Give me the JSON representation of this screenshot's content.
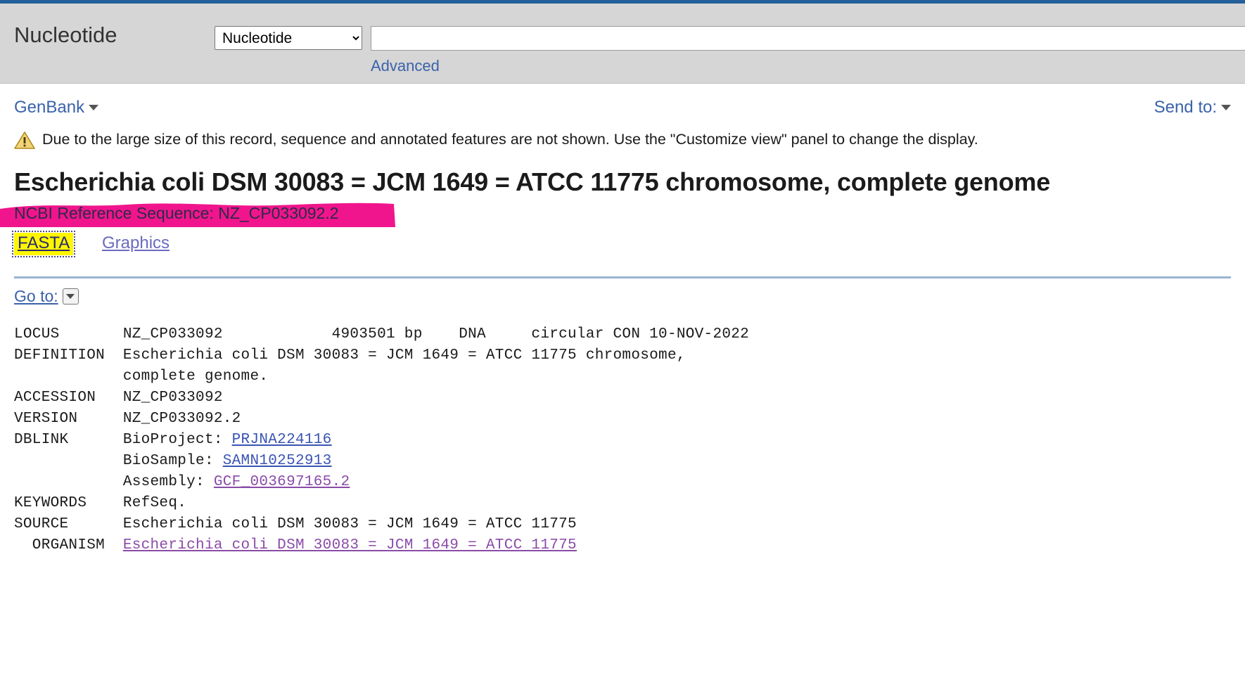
{
  "header": {
    "db_title": "Nucleotide",
    "db_select_value": "Nucleotide",
    "db_select_options": [
      "Nucleotide"
    ],
    "search_value": "",
    "search_placeholder": "",
    "advanced_label": "Advanced",
    "accent_color": "#24609b",
    "band_color": "#d6d6d6",
    "link_color": "#3a62ab"
  },
  "toolbar": {
    "format_label": "GenBank",
    "send_to_label": "Send to:"
  },
  "warning": {
    "icon": "warning-triangle-icon",
    "text": "Due to the large size of this record, sequence and annotated features are not shown. Use the \"Customize view\" panel to change the display."
  },
  "record": {
    "title": "Escherichia coli DSM 30083 = JCM 1649 = ATCC 11775 chromosome, complete genome",
    "reference_sequence": "NCBI Reference Sequence: NZ_CP033092.2",
    "highlight_pink": "#f0158c",
    "highlight_yellow": "#fff600"
  },
  "view_links": {
    "fasta": "FASTA",
    "graphics": "Graphics"
  },
  "goto": {
    "label": "Go to:",
    "icon": "chevron-down-icon"
  },
  "genbank": {
    "lines": [
      [
        {
          "t": "LOCUS       NZ_CP033092            4903501 bp    DNA     circular CON 10-NOV-2022"
        }
      ],
      [
        {
          "t": "DEFINITION  Escherichia coli DSM 30083 = JCM 1649 = ATCC 11775 chromosome,"
        }
      ],
      [
        {
          "t": "            complete genome."
        }
      ],
      [
        {
          "t": "ACCESSION   NZ_CP033092"
        }
      ],
      [
        {
          "t": "VERSION     NZ_CP033092.2"
        }
      ],
      [
        {
          "t": "DBLINK      BioProject: "
        },
        {
          "t": "PRJNA224116",
          "link": "blue"
        }
      ],
      [
        {
          "t": "            BioSample: "
        },
        {
          "t": "SAMN10252913",
          "link": "blue"
        }
      ],
      [
        {
          "t": "            Assembly: "
        },
        {
          "t": "GCF_003697165.2",
          "link": "visited"
        }
      ],
      [
        {
          "t": "KEYWORDS    RefSeq."
        }
      ],
      [
        {
          "t": "SOURCE      Escherichia coli DSM 30083 = JCM 1649 = ATCC 11775"
        }
      ],
      [
        {
          "t": "  ORGANISM  "
        },
        {
          "t": "Escherichia coli DSM 30083 = JCM 1649 = ATCC 11775",
          "link": "visited"
        }
      ]
    ]
  }
}
